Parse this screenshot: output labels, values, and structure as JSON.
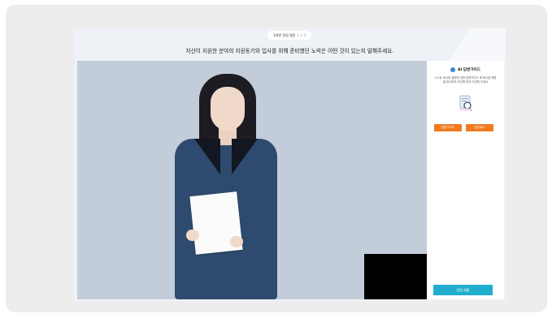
{
  "header": {
    "question_pill": {
      "label": "1/4번 면접 질문",
      "current": "1",
      "separator": "/",
      "total": "3"
    },
    "question_text": "자산이 지원한 분야의 지원동기와 입사를 위해 준비했던 노력은 어떤 것이 있는지 말해주세요."
  },
  "side_panel": {
    "title": "AI 답변가이드",
    "description": "스스로 생각한 질문에 관한 답변가이드 에 제시된 예문을 참고하여 조건에 맞게 구성해 주세요",
    "buttons": {
      "left_label": "답변가이드",
      "right_label": "답변예시",
      "submit_label": "답변 제출"
    }
  },
  "colors": {
    "stage_bg": "#c3ccd9",
    "orange": "#f07a1f",
    "teal": "#21aecd",
    "accent_dot": "#3a87d6"
  }
}
